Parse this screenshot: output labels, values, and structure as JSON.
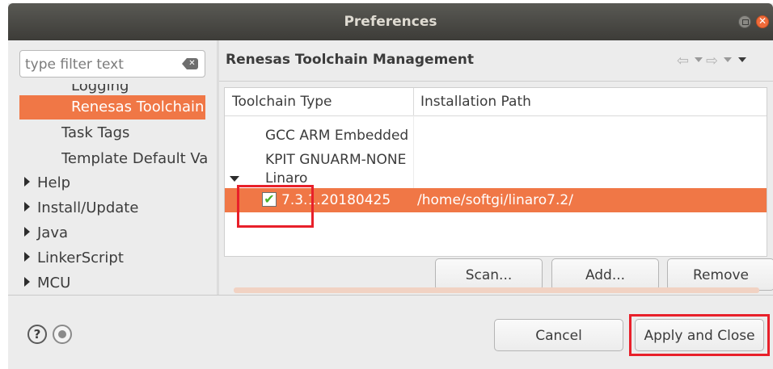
{
  "window": {
    "title": "Preferences"
  },
  "filter": {
    "placeholder": "type filter text"
  },
  "tree": {
    "partial_item": "Logging",
    "selected_item": "Renesas Toolchain Management",
    "items": [
      {
        "label": "Task Tags",
        "expandable": false
      },
      {
        "label": "Template Default Values",
        "expandable": false
      },
      {
        "label": "Help",
        "expandable": true
      },
      {
        "label": "Install/Update",
        "expandable": true
      },
      {
        "label": "Java",
        "expandable": true
      },
      {
        "label": "LinkerScript",
        "expandable": true
      },
      {
        "label": "MCU",
        "expandable": true
      }
    ]
  },
  "page": {
    "title": "Renesas Toolchain Management"
  },
  "table": {
    "columns": [
      "Toolchain Type",
      "Installation Path"
    ],
    "rows": [
      {
        "type": "GCC ARM Embedded",
        "path": ""
      },
      {
        "type": "KPIT GNUARM-NONE",
        "path": ""
      },
      {
        "type": "Linaro",
        "path": "",
        "expanded": true
      },
      {
        "type": "7.3.1.20180425",
        "path": "/home/softgi/linaro7.2/",
        "checked": true,
        "selected": true
      }
    ]
  },
  "buttons": {
    "scan": "Scan...",
    "add": "Add...",
    "remove": "Remove",
    "cancel": "Cancel",
    "apply_close": "Apply and Close"
  },
  "icons": {
    "help": "?",
    "check": "✔",
    "clear": "✕"
  },
  "colors": {
    "selection": "#f07746",
    "highlight_box": "#e8202a",
    "titlebar": "#3d3c38"
  }
}
